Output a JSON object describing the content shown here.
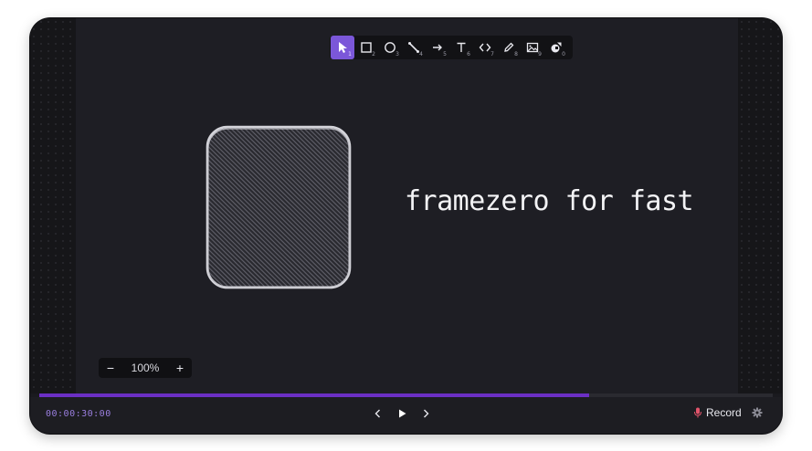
{
  "toolbar": {
    "tools": [
      {
        "name": "select",
        "shortcut": "1",
        "active": true
      },
      {
        "name": "rectangle",
        "shortcut": "2"
      },
      {
        "name": "ellipse",
        "shortcut": "3"
      },
      {
        "name": "line",
        "shortcut": "4"
      },
      {
        "name": "arrow",
        "shortcut": "5"
      },
      {
        "name": "text",
        "shortcut": "6"
      },
      {
        "name": "code",
        "shortcut": "7"
      },
      {
        "name": "pencil",
        "shortcut": "8"
      },
      {
        "name": "image",
        "shortcut": "9"
      },
      {
        "name": "shapes",
        "shortcut": "0"
      }
    ]
  },
  "canvas": {
    "caption": "framezero for fast"
  },
  "zoom": {
    "minus": "−",
    "value": "100%",
    "plus": "+"
  },
  "timeline": {
    "progress": 0.75,
    "time": "00:00:30:00"
  },
  "record": {
    "label": "Record"
  },
  "colors": {
    "accent": "#7b57d9",
    "progress": "#6b2fc4",
    "timecode": "#9b7fe0",
    "mic": "#e2546b"
  }
}
